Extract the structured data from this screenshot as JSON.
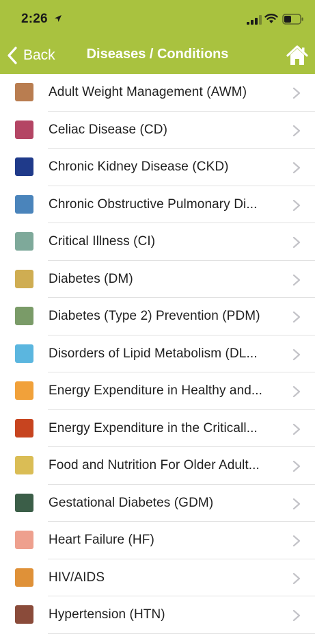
{
  "status_bar": {
    "time": "2:26",
    "icons": [
      "location-arrow-icon",
      "signal-icon",
      "wifi-icon",
      "battery-icon"
    ]
  },
  "nav": {
    "back_label": "Back",
    "title": "Diseases / Conditions",
    "home_icon": "home-icon",
    "bar_color": "#a9c23f"
  },
  "items": [
    {
      "label": "Adult Weight Management (AWM)",
      "color": "#b97d50"
    },
    {
      "label": "Celiac Disease (CD)",
      "color": "#b44564"
    },
    {
      "label": "Chronic Kidney Disease (CKD)",
      "color": "#1f3a8a"
    },
    {
      "label": "Chronic Obstructive Pulmonary Di...",
      "color": "#4a84bb"
    },
    {
      "label": "Critical Illness (CI)",
      "color": "#7ea99a"
    },
    {
      "label": "Diabetes (DM)",
      "color": "#cfad52"
    },
    {
      "label": "Diabetes (Type 2) Prevention (PDM)",
      "color": "#7a9b68"
    },
    {
      "label": "Disorders of Lipid Metabolism (DL...",
      "color": "#5bb6df"
    },
    {
      "label": "Energy Expenditure in Healthy and...",
      "color": "#f1a13a"
    },
    {
      "label": "Energy Expenditure in the Criticall...",
      "color": "#c7441f"
    },
    {
      "label": "Food and Nutrition For Older Adult...",
      "color": "#dabd55"
    },
    {
      "label": "Gestational Diabetes (GDM)",
      "color": "#3b5e48"
    },
    {
      "label": "Heart Failure (HF)",
      "color": "#eea08e"
    },
    {
      "label": "HIV/AIDS",
      "color": "#df9138"
    },
    {
      "label": "Hypertension (HTN)",
      "color": "#8a4b3a"
    }
  ]
}
